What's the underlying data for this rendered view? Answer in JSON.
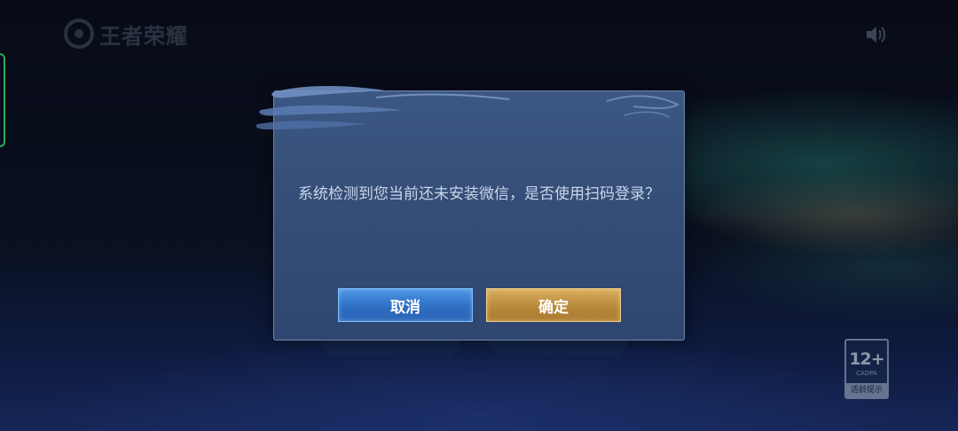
{
  "game": {
    "logo_text": "王者荣耀",
    "sound_icon": "speaker-icon",
    "age_rating": {
      "number": "12+",
      "sub": "CADPA",
      "footer": "适龄提示"
    }
  },
  "dialog": {
    "message": "系统检测到您当前还未安装微信，是否使用扫码登录？",
    "cancel_label": "取消",
    "confirm_label": "确定"
  },
  "colors": {
    "cancel_button": "#2e6fc4",
    "confirm_button": "#b98a3c",
    "dialog_bg": "#354f78"
  }
}
